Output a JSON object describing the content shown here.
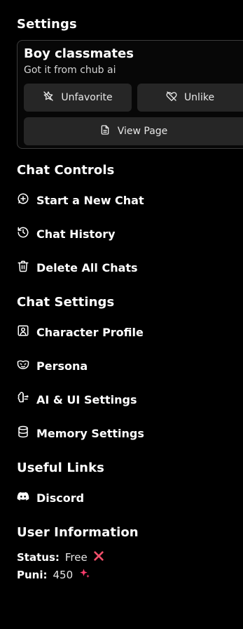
{
  "header": {
    "title": "Settings"
  },
  "character": {
    "name": "Boy classmates",
    "tagline": "Got it from chub ai",
    "unfavorite_label": "Unfavorite",
    "unlike_label": "Unlike",
    "view_page_label": "View Page"
  },
  "chat_controls": {
    "title": "Chat Controls",
    "items": [
      {
        "label": "Start a New Chat",
        "icon": "message-plus-icon"
      },
      {
        "label": "Chat History",
        "icon": "history-icon"
      },
      {
        "label": "Delete All Chats",
        "icon": "trash-icon"
      }
    ]
  },
  "chat_settings": {
    "title": "Chat Settings",
    "items": [
      {
        "label": "Character Profile",
        "icon": "user-square-icon"
      },
      {
        "label": "Persona",
        "icon": "mask-icon"
      },
      {
        "label": "AI & UI Settings",
        "icon": "brain-icon"
      },
      {
        "label": "Memory Settings",
        "icon": "database-icon"
      }
    ]
  },
  "useful_links": {
    "title": "Useful Links",
    "items": [
      {
        "label": "Discord",
        "icon": "discord-icon"
      }
    ]
  },
  "user_info": {
    "title": "User Information",
    "status_label": "Status:",
    "status_value": "Free",
    "puni_label": "Puni:",
    "puni_value": "450"
  },
  "colors": {
    "background": "#000000",
    "button": "#262626",
    "accent_red": "#f04f6a",
    "accent_pink": "#ff3d6e"
  }
}
